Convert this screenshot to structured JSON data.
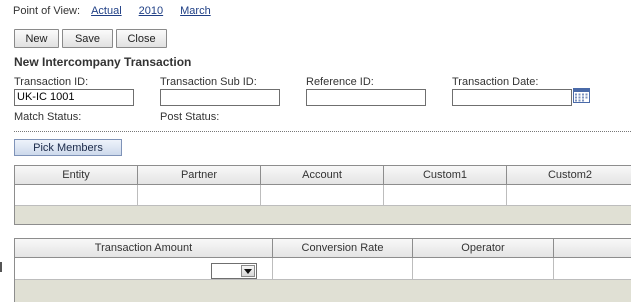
{
  "pov": {
    "label": "Point of View:",
    "scenario": "Actual",
    "year": "2010",
    "period": "March"
  },
  "toolbar": {
    "new_label": "New",
    "save_label": "Save",
    "close_label": "Close"
  },
  "form": {
    "title": "New Intercompany Transaction",
    "transaction_id_label": "Transaction ID:",
    "transaction_id_value": "UK-IC 1001",
    "transaction_sub_id_label": "Transaction Sub ID:",
    "transaction_sub_id_value": "",
    "reference_id_label": "Reference ID:",
    "reference_id_value": "",
    "transaction_date_label": "Transaction Date:",
    "transaction_date_value": "",
    "match_status_label": "Match Status:",
    "post_status_label": "Post Status:"
  },
  "pick_members_label": "Pick Members",
  "members_grid": {
    "columns": [
      "Entity",
      "Partner",
      "Account",
      "Custom1",
      "Custom2"
    ]
  },
  "amount_grid": {
    "columns": [
      "Transaction Amount",
      "Conversion Rate",
      "Operator",
      ""
    ]
  },
  "icons": {
    "calendar": "calendar-icon",
    "dropdown": "chevron-down-icon"
  }
}
